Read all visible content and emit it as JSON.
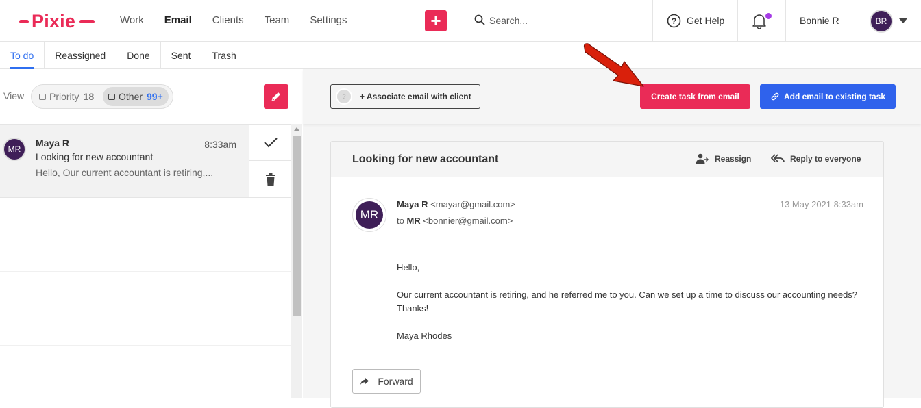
{
  "brand": {
    "name": "Pixie",
    "color": "#ea2b57"
  },
  "nav": {
    "items": [
      {
        "label": "Work",
        "active": false
      },
      {
        "label": "Email",
        "active": true
      },
      {
        "label": "Clients",
        "active": false
      },
      {
        "label": "Team",
        "active": false
      },
      {
        "label": "Settings",
        "active": false
      }
    ],
    "add_icon": "plus-icon"
  },
  "search": {
    "placeholder": "Search..."
  },
  "help": {
    "label": "Get Help"
  },
  "notifications": {
    "has_unread": true,
    "dot_color": "#a63ce6"
  },
  "user": {
    "name": "Bonnie R",
    "initials": "BR"
  },
  "subtabs": [
    {
      "label": "To do",
      "active": true
    },
    {
      "label": "Reassigned",
      "active": false
    },
    {
      "label": "Done",
      "active": false
    },
    {
      "label": "Sent",
      "active": false
    },
    {
      "label": "Trash",
      "active": false
    }
  ],
  "view": {
    "label": "View",
    "priority": {
      "label": "Priority",
      "count": "18"
    },
    "other": {
      "label": "Other",
      "count": "99+",
      "selected": true
    }
  },
  "inbox": [
    {
      "initials": "MR",
      "from": "Maya R",
      "time": "8:33am",
      "subject": "Looking for new accountant",
      "preview": "Hello, Our current accountant is retiring,..."
    }
  ],
  "actions": {
    "associate": "+ Associate email with client",
    "create_task": "Create task from email",
    "add_to_task": "Add email to existing task",
    "create_color": "#ea2b57",
    "add_color": "#2f62ec"
  },
  "email": {
    "subject": "Looking for new accountant",
    "reassign": "Reassign",
    "reply_all": "Reply to everyone",
    "initials": "MR",
    "from_name": "Maya R",
    "from_addr": "<mayar@gmail.com>",
    "to_prefix": "to",
    "to_name": "MR",
    "to_addr": "<bonnier@gmail.com>",
    "date": "13 May 2021 8:33am",
    "body": {
      "greeting": "Hello,",
      "paragraph": "Our current accountant is retiring, and he referred me to you. Can we set up a time to discuss our accounting needs? Thanks!",
      "signature": "Maya Rhodes"
    },
    "forward": "Forward"
  },
  "annotation": {
    "arrow_color": "#d9200b"
  }
}
